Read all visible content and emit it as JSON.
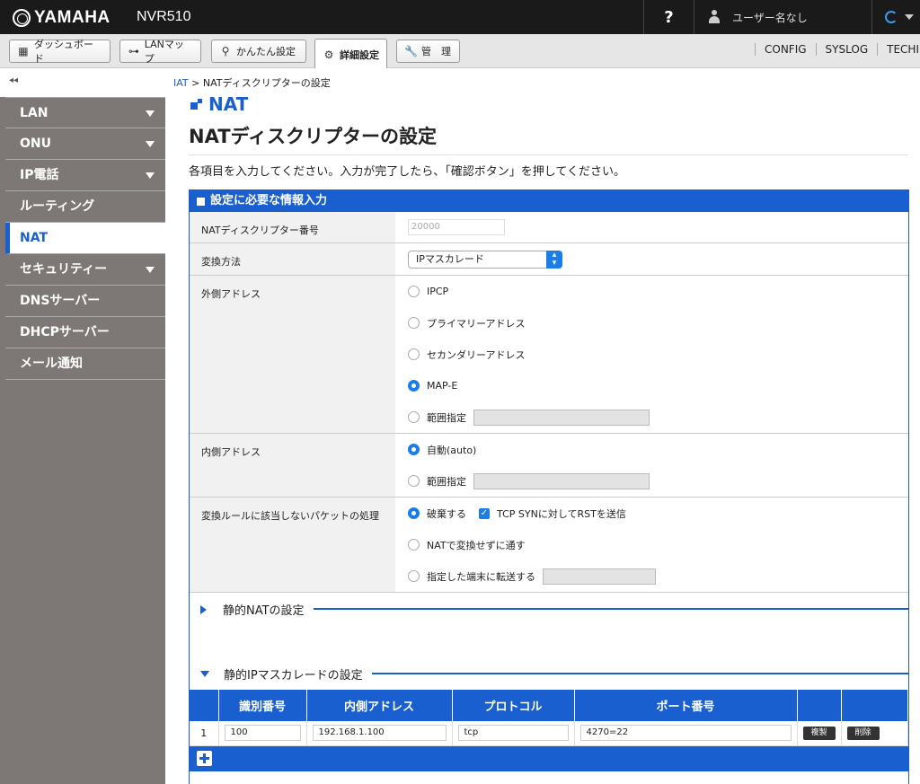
{
  "header": {
    "brand": "YAMAHA",
    "model": "NVR510",
    "help": "?",
    "user": "ユーザー名なし"
  },
  "tabs": [
    {
      "label": "ダッシュボード",
      "icon": "dashboard-icon"
    },
    {
      "label": "LANマップ",
      "icon": "lan-map-icon"
    },
    {
      "label": "かんたん設定",
      "icon": "wand-icon"
    },
    {
      "label": "詳細設定",
      "icon": "gear-icon",
      "active": true
    },
    {
      "label": "管　理",
      "icon": "wrench-icon"
    }
  ],
  "sublinks": [
    "CONFIG",
    "SYSLOG",
    "TECHINF"
  ],
  "sidebar": {
    "collapse": "◂◂",
    "items": [
      {
        "label": "LAN",
        "arrow": true
      },
      {
        "label": "ONU",
        "arrow": true
      },
      {
        "label": "IP電話",
        "arrow": true
      },
      {
        "label": "ルーティング",
        "arrow": false
      },
      {
        "label": "NAT",
        "arrow": false,
        "active": true
      },
      {
        "label": "セキュリティー",
        "arrow": true
      },
      {
        "label": "DNSサーバー",
        "arrow": false
      },
      {
        "label": "DHCPサーバー",
        "arrow": false
      },
      {
        "label": "メール通知",
        "arrow": false
      }
    ]
  },
  "breadcrumb": {
    "link": "NAT",
    "sep": " > ",
    "current": "NATディスクリプターの設定"
  },
  "section": "NAT",
  "page_title": "NATディスクリプターの設定",
  "intro": "各項目を入力してください。入力が完了したら、「確認ボタン」を押してください。",
  "form": {
    "header": "設定に必要な情報入力",
    "descriptor_label": "NATディスクリプター番号",
    "descriptor_placeholder": "20000",
    "method_label": "変換方法",
    "method_value": "IPマスカレード",
    "outer_label": "外側アドレス",
    "outer_options": [
      "IPCP",
      "プライマリーアドレス",
      "セカンダリーアドレス",
      "MAP-E",
      "範囲指定"
    ],
    "inner_label": "内側アドレス",
    "inner_options": [
      "自動(auto)",
      "範囲指定"
    ],
    "unmatched_label": "変換ルールに該当しないパケットの処理",
    "unmatched_options": [
      "破棄する",
      "NATで変換せずに通す",
      "指定した端末に転送する"
    ],
    "tcp_check_label": "TCP SYNに対してRSTを送信"
  },
  "static_nat": "静的NATの設定",
  "static_masq": "静的IPマスカレードの設定",
  "table": {
    "headers": [
      "識別番号",
      "内側アドレス",
      "プロトコル",
      "ポート番号"
    ],
    "rows": [
      {
        "no": "1",
        "id": "100",
        "inner": "192.168.1.100",
        "protocol": "tcp",
        "port": "4270=22",
        "copy": "複製",
        "delete": "削除"
      }
    ]
  },
  "colors": {
    "accent": "#1a5fd0",
    "radio": "#1a7de8",
    "sidebar": "#7d7875"
  }
}
